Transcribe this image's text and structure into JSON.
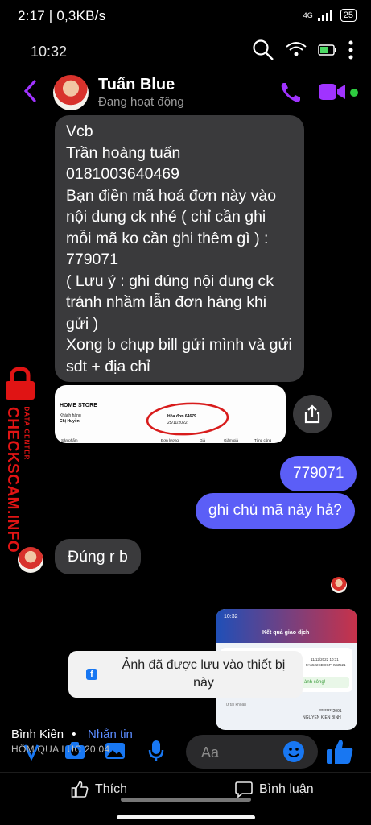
{
  "outer_status": {
    "time": "2:17 | 0,3KB/s",
    "network": "4G",
    "battery": "25"
  },
  "inner_status": {
    "time": "10:32"
  },
  "header": {
    "name": "Tuấn Blue",
    "status": "Đang hoạt động"
  },
  "messages": {
    "incoming_1": "Vcb\nTrần hoàng tuấn\n0181003640469\nBạn điền mã hoá đơn này vào nội dung ck nhé ( chỉ cần ghi mỗi mã ko cần ghi thêm gì ) :\n779071\n( Lưu ý : ghi đúng nội dung ck tránh nhầm lẫn đơn hàng khi gửi )\nXong b chụp bill gửi mình và gửi sdt + địa chỉ",
    "outgoing_1": "779071",
    "outgoing_2": "ghi chú mã này hả?",
    "incoming_2": "Đúng r b"
  },
  "receipt": {
    "store": "HOME STORE",
    "customer_label": "Khách hàng",
    "customer_name": "Chị Huyền",
    "invoice": "Hóa đơn 64679",
    "date": "25/11/2022",
    "col1": "Sản phẩm",
    "col2": "Đơn lượng",
    "col3": "Giá",
    "col4": "Giảm giá",
    "col5": "Tổng cộng"
  },
  "phone_shot": {
    "time": "10:32",
    "title": "Kết quả giao dịch",
    "datetime": "11/12/2022 10:31",
    "ref": "FA5522CDDGPHWZ521",
    "success": "ành công!",
    "from_label": "Từ tài khoản",
    "account": "*********2091",
    "holder": "NGUYEN KIEN BINH"
  },
  "toast": {
    "text": "Ảnh đã được lưu vào thiết bị này"
  },
  "watermark": {
    "brand": "CHECKSCAM.INFO",
    "sub": "DATA CENTER"
  },
  "post": {
    "user": "Bình Kiên",
    "separator": "•",
    "follow": "Nhắn tin",
    "time": "HÔM QUA LÚC 20:04"
  },
  "composer": {
    "placeholder": "Aa"
  },
  "actions": {
    "like": "Thích",
    "comment": "Bình luận"
  },
  "colors": {
    "accent": "#5b5ef7",
    "purple": "#a033ff",
    "incoming": "#3a3a3c"
  }
}
